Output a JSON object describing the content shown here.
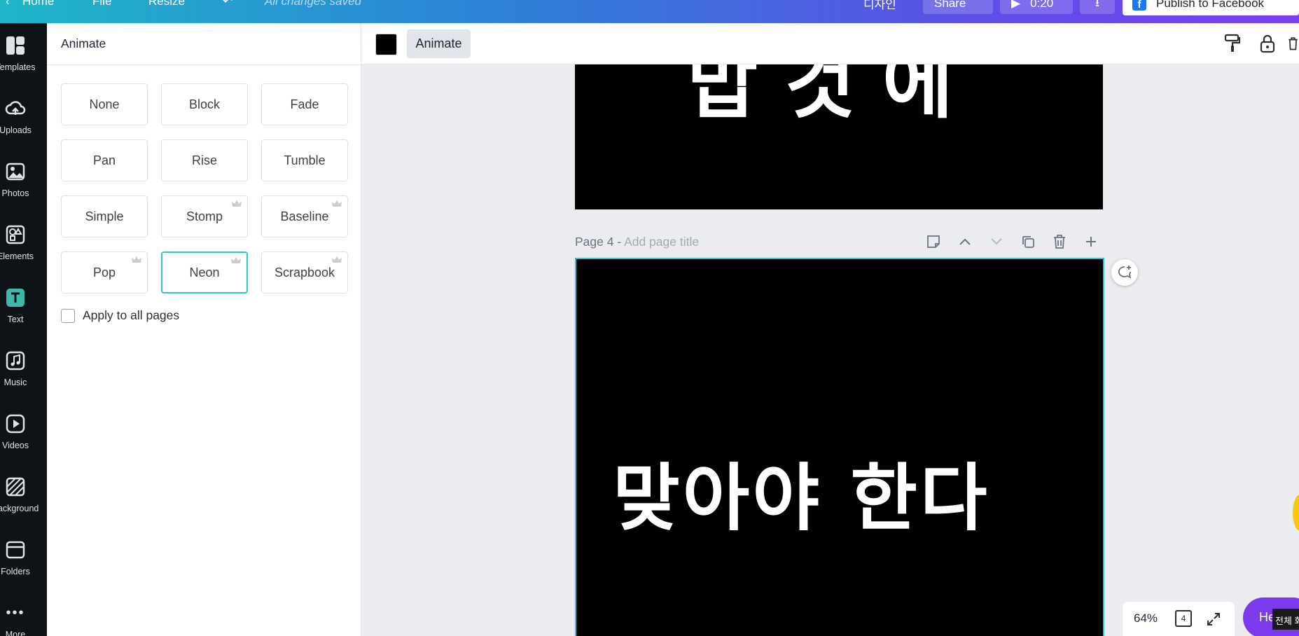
{
  "topbar": {
    "home": "Home",
    "file": "File",
    "resize": "Resize",
    "saved_status": "All changes saved",
    "korean_label": "디자인",
    "share": "Share",
    "duration": "0:20",
    "publish": "Publish to Facebook"
  },
  "rail": {
    "items": [
      {
        "label": "Templates",
        "icon": "templates-icon"
      },
      {
        "label": "Uploads",
        "icon": "upload-cloud-icon"
      },
      {
        "label": "Photos",
        "icon": "photo-icon"
      },
      {
        "label": "Elements",
        "icon": "shapes-icon"
      },
      {
        "label": "Text",
        "icon": "text-icon"
      },
      {
        "label": "Music",
        "icon": "music-note-icon"
      },
      {
        "label": "Videos",
        "icon": "play-icon"
      },
      {
        "label": "Background",
        "icon": "hatch-icon"
      },
      {
        "label": "Folders",
        "icon": "folder-icon"
      },
      {
        "label": "More",
        "icon": "more-dots-icon"
      }
    ]
  },
  "panel": {
    "title": "Animate",
    "options": [
      {
        "label": "None",
        "premium": false
      },
      {
        "label": "Block",
        "premium": false
      },
      {
        "label": "Fade",
        "premium": false
      },
      {
        "label": "Pan",
        "premium": false
      },
      {
        "label": "Rise",
        "premium": false
      },
      {
        "label": "Tumble",
        "premium": false
      },
      {
        "label": "Simple",
        "premium": false
      },
      {
        "label": "Stomp",
        "premium": true
      },
      {
        "label": "Baseline",
        "premium": true
      },
      {
        "label": "Pop",
        "premium": true
      },
      {
        "label": "Neon",
        "premium": true,
        "selected": true
      },
      {
        "label": "Scrapbook",
        "premium": true
      }
    ],
    "apply_all": "Apply to all pages"
  },
  "context_toolbar": {
    "color": "#000000",
    "animate": "Animate"
  },
  "canvas": {
    "page3_text": "맙 것 에",
    "page4_label": "Page 4 -",
    "page4_title_placeholder": "Add page title",
    "page4_text": "맞아야 한다"
  },
  "bottom": {
    "zoom": "64%",
    "page_count": "4",
    "help": "Help",
    "tooltip": "전체 화"
  },
  "colors": {
    "accent": "#2ec4d6",
    "help_purple": "#7c3aed",
    "rail_bg": "#0e1318"
  }
}
